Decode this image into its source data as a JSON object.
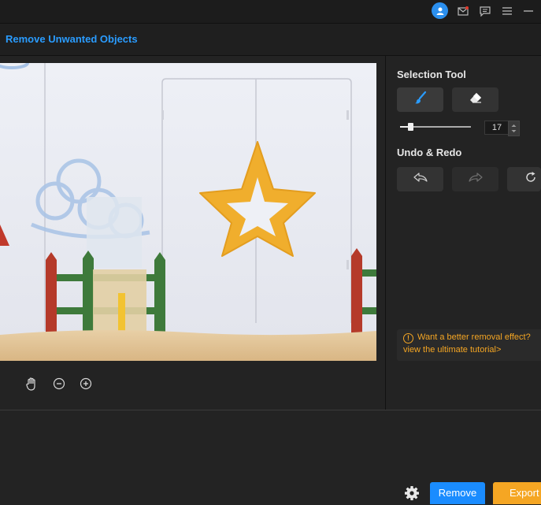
{
  "titlebar": {
    "icons": [
      "user-icon",
      "mail-icon",
      "message-icon",
      "menu-icon",
      "minimize-icon"
    ]
  },
  "header": {
    "title": "Remove Unwanted Objects"
  },
  "canvas": {
    "zoom_tools": [
      "hand-icon",
      "zoom-out-icon",
      "zoom-in-icon"
    ]
  },
  "sidebar": {
    "selection_tool_title": "Selection Tool",
    "tools": [
      "brush-icon",
      "eraser-icon"
    ],
    "brush_size": "17",
    "brush_size_fraction": 0.15,
    "undo_redo_title": "Undo & Redo",
    "history_buttons": [
      "undo-icon",
      "redo-icon",
      "reset-icon"
    ],
    "tip_line1": "Want a better removal effect?",
    "tip_line2": "view the ultimate tutorial>"
  },
  "footer": {
    "remove_label": "Remove",
    "export_label": "Export"
  },
  "colors": {
    "accent": "#1a8cff",
    "export": "#f5a623",
    "background": "#232323"
  }
}
